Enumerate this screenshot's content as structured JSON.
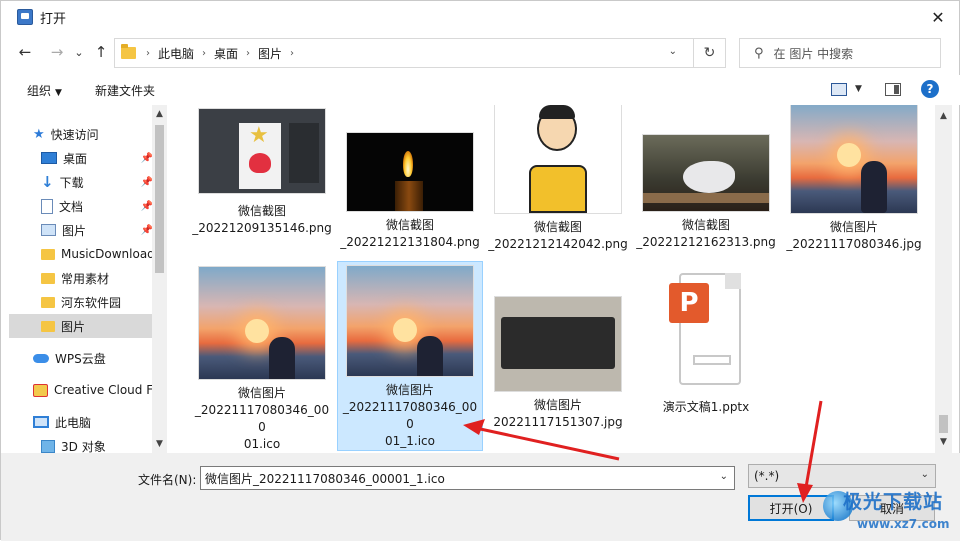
{
  "window": {
    "title": "打开",
    "close_glyph": "✕"
  },
  "nav": {
    "back": "←",
    "forward": "→",
    "recent": "⌄",
    "up": "↑",
    "breadcrumb": [
      "此电脑",
      "桌面",
      "图片"
    ],
    "refresh": "↻",
    "search_placeholder": "在 图片 中搜索"
  },
  "toolbar": {
    "organize": "组织",
    "new_folder": "新建文件夹",
    "help": "?"
  },
  "sidebar": {
    "items": [
      {
        "label": "快速访问",
        "icon": "star-icon",
        "pinned": false
      },
      {
        "label": "桌面",
        "icon": "desktop-icon",
        "pinned": true
      },
      {
        "label": "下载",
        "icon": "download-icon",
        "pinned": true
      },
      {
        "label": "文档",
        "icon": "document-icon",
        "pinned": true
      },
      {
        "label": "图片",
        "icon": "pictures-icon",
        "pinned": true
      },
      {
        "label": "MusicDownload",
        "icon": "folder-icon",
        "pinned": false
      },
      {
        "label": "常用素材",
        "icon": "folder-icon",
        "pinned": false
      },
      {
        "label": "河东软件园",
        "icon": "folder-icon",
        "pinned": false
      },
      {
        "label": "图片",
        "icon": "folder-icon",
        "pinned": false,
        "selected": true
      },
      {
        "label": "WPS云盘",
        "icon": "cloud-icon",
        "pinned": false
      },
      {
        "label": "Creative Cloud Fi",
        "icon": "creative-cloud-icon",
        "pinned": false
      },
      {
        "label": "此电脑",
        "icon": "computer-icon",
        "pinned": false
      },
      {
        "label": "3D 对象",
        "icon": "3d-objects-icon",
        "pinned": false
      }
    ]
  },
  "files": [
    {
      "line1": "微信截图",
      "line2": "_20221209135146.png",
      "thumb": "photoshop-screenshot"
    },
    {
      "line1": "微信截图",
      "line2": "_20221212131804.png",
      "thumb": "candle"
    },
    {
      "line1": "微信截图",
      "line2": "_20221212142042.png",
      "thumb": "cartoon-man"
    },
    {
      "line1": "微信截图",
      "line2": "_20221212162313.png",
      "thumb": "dove"
    },
    {
      "line1": "微信图片",
      "line2": "_20221117080346.jpg",
      "thumb": "sunset-girl"
    },
    {
      "line1": "微信图片",
      "line2": "_20221117080346_000",
      "line3": "01.ico",
      "thumb": "sunset-girl"
    },
    {
      "line1": "微信图片",
      "line2": "_20221117080346_000",
      "line3": "01_1.ico",
      "thumb": "sunset-girl",
      "selected": true
    },
    {
      "line1": "微信图片",
      "line2": "20221117151307.jpg",
      "thumb": "keyboard"
    },
    {
      "line1": "演示文稿1.pptx",
      "thumb": "pptx-file"
    }
  ],
  "bottom": {
    "filename_label": "文件名(N):",
    "filename_value": "微信图片_20221117080346_00001_1.ico",
    "filter_value": "(*.*)",
    "open_button": "打开(O)",
    "cancel_button": "取消"
  },
  "watermark": {
    "text1": "极光下载站",
    "text2": "www.xz7.com"
  },
  "colors": {
    "accent": "#0078d7",
    "selection": "#cce8ff",
    "annotation_arrow": "#e02020"
  }
}
